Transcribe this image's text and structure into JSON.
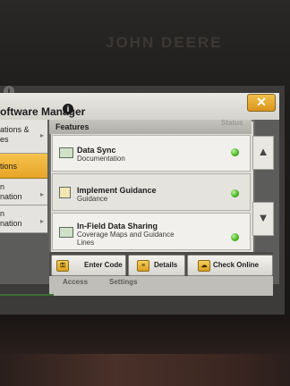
{
  "device": {
    "brand_text": "JOHN DEERE"
  },
  "dialog": {
    "title": "oftware Manager",
    "close_label": "✕"
  },
  "nav": {
    "items": [
      {
        "label": "ations &\nes"
      },
      {
        "label": "tions"
      },
      {
        "label": "n\nnation"
      },
      {
        "label": "n\nnation"
      }
    ]
  },
  "features": {
    "header": "Features",
    "status_header": "Status",
    "rows": [
      {
        "title": "Data Sync",
        "subtitle": "Documentation",
        "status": "green"
      },
      {
        "title": "Implement Guidance",
        "subtitle": "Guidance",
        "status": "green"
      },
      {
        "title": "In-Field Data Sharing",
        "subtitle": "Coverage Maps and Guidance\nLines",
        "status": "green"
      }
    ]
  },
  "footer": {
    "enter_code": "Enter Code",
    "details": "Details",
    "check_online": "Check Online"
  },
  "taskbar": {
    "left": "Access",
    "right": "Settings"
  }
}
